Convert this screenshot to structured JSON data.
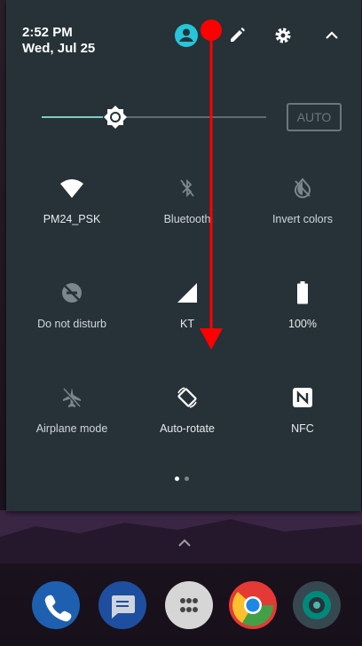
{
  "status": {
    "time": "2:52 PM",
    "date": "Wed, Jul 25"
  },
  "header_icons": [
    "account-icon",
    "edit-icon",
    "settings-icon",
    "collapse-icon"
  ],
  "brightness": {
    "level": 0.33,
    "auto_label": "AUTO"
  },
  "tiles": [
    {
      "label": "PM24_PSK",
      "icon": "wifi-icon",
      "active": true
    },
    {
      "label": "Bluetooth",
      "icon": "bluetooth-icon",
      "active": false
    },
    {
      "label": "Invert colors",
      "icon": "invert-colors-icon",
      "active": false
    },
    {
      "label": "Do not disturb",
      "icon": "do-not-disturb-icon",
      "active": false
    },
    {
      "label": "KT",
      "icon": "cell-signal-icon",
      "active": true
    },
    {
      "label": "100%",
      "icon": "battery-icon",
      "active": true
    },
    {
      "label": "Airplane mode",
      "icon": "airplane-icon",
      "active": false
    },
    {
      "label": "Auto-rotate",
      "icon": "auto-rotate-icon",
      "active": true
    },
    {
      "label": "NFC",
      "icon": "nfc-icon",
      "active": true
    }
  ],
  "pager": {
    "pages": 2,
    "current": 1
  },
  "dock": [
    "phone-app-icon",
    "messages-app-icon",
    "app-drawer-icon",
    "chrome-app-icon",
    "camera-app-icon"
  ],
  "colors": {
    "panel": "#263238",
    "accent": "#80cbc4",
    "avatar": "#26c6da",
    "annotation": "#ff0000"
  }
}
